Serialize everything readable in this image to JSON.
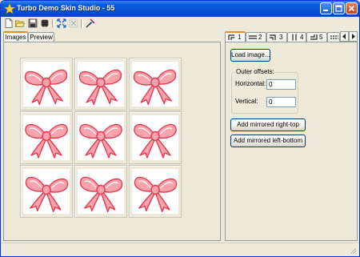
{
  "window": {
    "title": "Turbo Demo Skin Studio - 55",
    "controls": [
      "minimize",
      "maximize",
      "close"
    ]
  },
  "toolbar": {
    "icons": [
      "new-file-icon",
      "open-folder-icon",
      "save-icon",
      "settings-chip-icon",
      "fit-icon",
      "zoom-icon",
      "tool-icon"
    ]
  },
  "left_tabs": [
    {
      "label": "Images",
      "active": true
    },
    {
      "label": "Preview",
      "active": false
    }
  ],
  "grid": {
    "rows": 3,
    "cols": 3,
    "image": "pink-bow-image",
    "accent": "#f25a6e"
  },
  "right_tabs": [
    {
      "num": "1",
      "active": true
    },
    {
      "num": "2",
      "active": false
    },
    {
      "num": "3",
      "active": false
    },
    {
      "num": "4",
      "active": false
    },
    {
      "num": "5",
      "active": false
    },
    {
      "num": "",
      "active": false
    }
  ],
  "properties": {
    "load_image_label": "Load image...",
    "outer_offsets_title": "Outer offsets:",
    "horizontal_label": "Horizontal:",
    "horizontal_value": "0",
    "vertical_label": "Vertical:",
    "vertical_value": "0",
    "add_mirrored_right_top_label": "Add mirrored right-top",
    "add_mirrored_left_bottom_label": "Add mirrored left-bottom"
  },
  "colors": {
    "titlebar": "#0553d6",
    "tab_highlight": "#e68b2c",
    "bow_fill": "#f9a3ad",
    "bow_stroke": "#e8384f"
  }
}
